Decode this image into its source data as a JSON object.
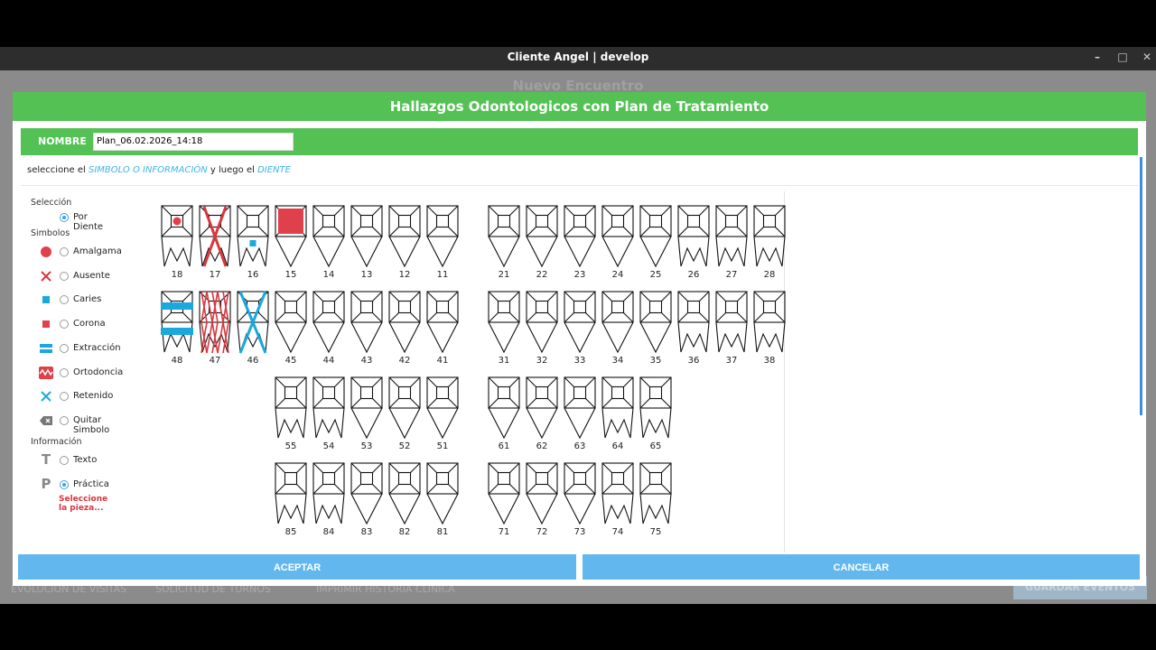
{
  "window": {
    "title": "Cliente Angel | develop"
  },
  "background": {
    "title": "Nuevo Encuentro",
    "bottom_links": [
      "EVOLUCION DE VISITAS",
      "SOLICITUD DE TURNOS",
      "IMPRIMIR HISTORIA CLINICA"
    ],
    "bottom_button": "GUARDAR EVENTOS"
  },
  "modal": {
    "title": "Hallazgos Odontologicos con Plan de Tratamiento",
    "name_label": "NOMBRE",
    "name_value": "Plan_06.02.2026_14:18",
    "hint": {
      "pre": "seleccione el ",
      "em1": "SIMBOLO O INFORMACIÓN",
      "mid": " y luego el ",
      "em2": "DIENTE"
    },
    "seleccion": {
      "title": "Selección",
      "option": "Por Diente"
    },
    "simbolos": {
      "title": "Simbolos",
      "items": [
        {
          "label": "Amalgama",
          "icon": "amalgama-icon",
          "color": "#e0404b"
        },
        {
          "label": "Ausente",
          "icon": "ausente-icon",
          "color": "#d9363e"
        },
        {
          "label": "Caries",
          "icon": "caries-icon",
          "color": "#1aa8dd"
        },
        {
          "label": "Corona",
          "icon": "corona-icon",
          "color": "#e0404b"
        },
        {
          "label": "Extracción",
          "icon": "extraccion-icon",
          "color": "#1aa8dd"
        },
        {
          "label": "Ortodoncia",
          "icon": "ortodoncia-icon",
          "color": "#e0404b"
        },
        {
          "label": "Retenido",
          "icon": "retenido-icon",
          "color": "#1aa8dd"
        },
        {
          "label": "Quitar Simbolo",
          "icon": "quitar-simbolo-icon",
          "color": "#777777"
        }
      ]
    },
    "informacion": {
      "title": "Información",
      "items": [
        {
          "label": "Texto",
          "icon": "texto-icon",
          "glyph": "T"
        },
        {
          "label": "Práctica",
          "icon": "practica-icon",
          "glyph": "P"
        }
      ]
    },
    "selected_option": "Práctica",
    "warning": "Seleccione la pieza...",
    "rows": [
      [
        "18",
        "17",
        "16",
        "15",
        "14",
        "13",
        "12",
        "11",
        "21",
        "22",
        "23",
        "24",
        "25",
        "26",
        "27",
        "28"
      ],
      [
        "48",
        "47",
        "46",
        "45",
        "44",
        "43",
        "42",
        "41",
        "31",
        "32",
        "33",
        "34",
        "35",
        "36",
        "37",
        "38"
      ],
      [
        "55",
        "54",
        "53",
        "52",
        "51",
        "61",
        "62",
        "63",
        "64",
        "65"
      ],
      [
        "85",
        "84",
        "83",
        "82",
        "81",
        "71",
        "72",
        "73",
        "74",
        "75"
      ]
    ],
    "findings": {
      "18": "amalgama",
      "17": "ausente",
      "16": "caries",
      "15": "corona",
      "48": "extraccion",
      "47": "ortodoncia",
      "46": "retenido"
    },
    "accept": "ACEPTAR",
    "cancel": "CANCELAR"
  }
}
